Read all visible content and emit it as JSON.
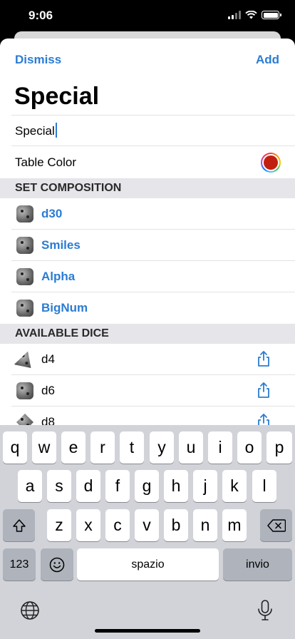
{
  "status_bar": {
    "time": "9:06"
  },
  "nav": {
    "dismiss_label": "Dismiss",
    "add_label": "Add"
  },
  "title": "Special",
  "name_field": {
    "value": "Special"
  },
  "table_color": {
    "label": "Table Color",
    "color": "#c2200f"
  },
  "sections": {
    "set_composition": {
      "header": "SET COMPOSITION",
      "items": [
        {
          "label": "d30"
        },
        {
          "label": "Smiles"
        },
        {
          "label": "Alpha"
        },
        {
          "label": "BigNum"
        }
      ]
    },
    "available_dice": {
      "header": "AVAILABLE DICE",
      "items": [
        {
          "label": "d4"
        },
        {
          "label": "d6"
        },
        {
          "label": "d8"
        }
      ]
    }
  },
  "keyboard": {
    "row1": [
      "q",
      "w",
      "e",
      "r",
      "t",
      "y",
      "u",
      "i",
      "o",
      "p"
    ],
    "row2": [
      "a",
      "s",
      "d",
      "f",
      "g",
      "h",
      "j",
      "k",
      "l"
    ],
    "row3": [
      "z",
      "x",
      "c",
      "v",
      "b",
      "n",
      "m"
    ],
    "numbers_label": "123",
    "space_label": "spazio",
    "return_label": "invio"
  },
  "colors": {
    "accent": "#2b7cd3",
    "section_bg": "#e5e5ea",
    "keyboard_bg": "#d1d3d9"
  }
}
